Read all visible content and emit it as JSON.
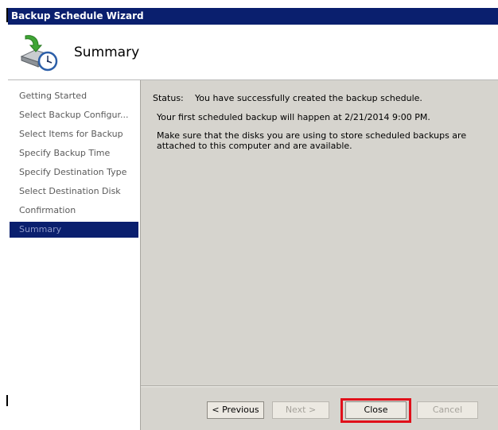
{
  "window": {
    "title": "Backup Schedule Wizard"
  },
  "header": {
    "title": "Summary",
    "icon": "backup-schedule-clock-icon"
  },
  "nav": {
    "items": [
      {
        "label": "Getting Started"
      },
      {
        "label": "Select Backup Configur..."
      },
      {
        "label": "Select Items for Backup"
      },
      {
        "label": "Specify Backup Time"
      },
      {
        "label": "Specify Destination Type"
      },
      {
        "label": "Select Destination Disk"
      },
      {
        "label": "Confirmation"
      },
      {
        "label": "Summary"
      }
    ],
    "active_index": 7
  },
  "content": {
    "status_label": "Status:",
    "status_value": "You have successfully created the backup schedule.",
    "first_backup": "Your first scheduled backup will happen at 2/21/2014 9:00 PM.",
    "disk_note": "Make sure that the disks you are using to store scheduled backups are attached to this computer and are available."
  },
  "buttons": {
    "previous": "< Previous",
    "next": "Next >",
    "close": "Close",
    "cancel": "Cancel"
  },
  "colors": {
    "titlebar": "#0a1f6e",
    "active_nav": "#0a1f6e",
    "content_bg": "#d6d4ce",
    "highlight": "#e0101a"
  }
}
